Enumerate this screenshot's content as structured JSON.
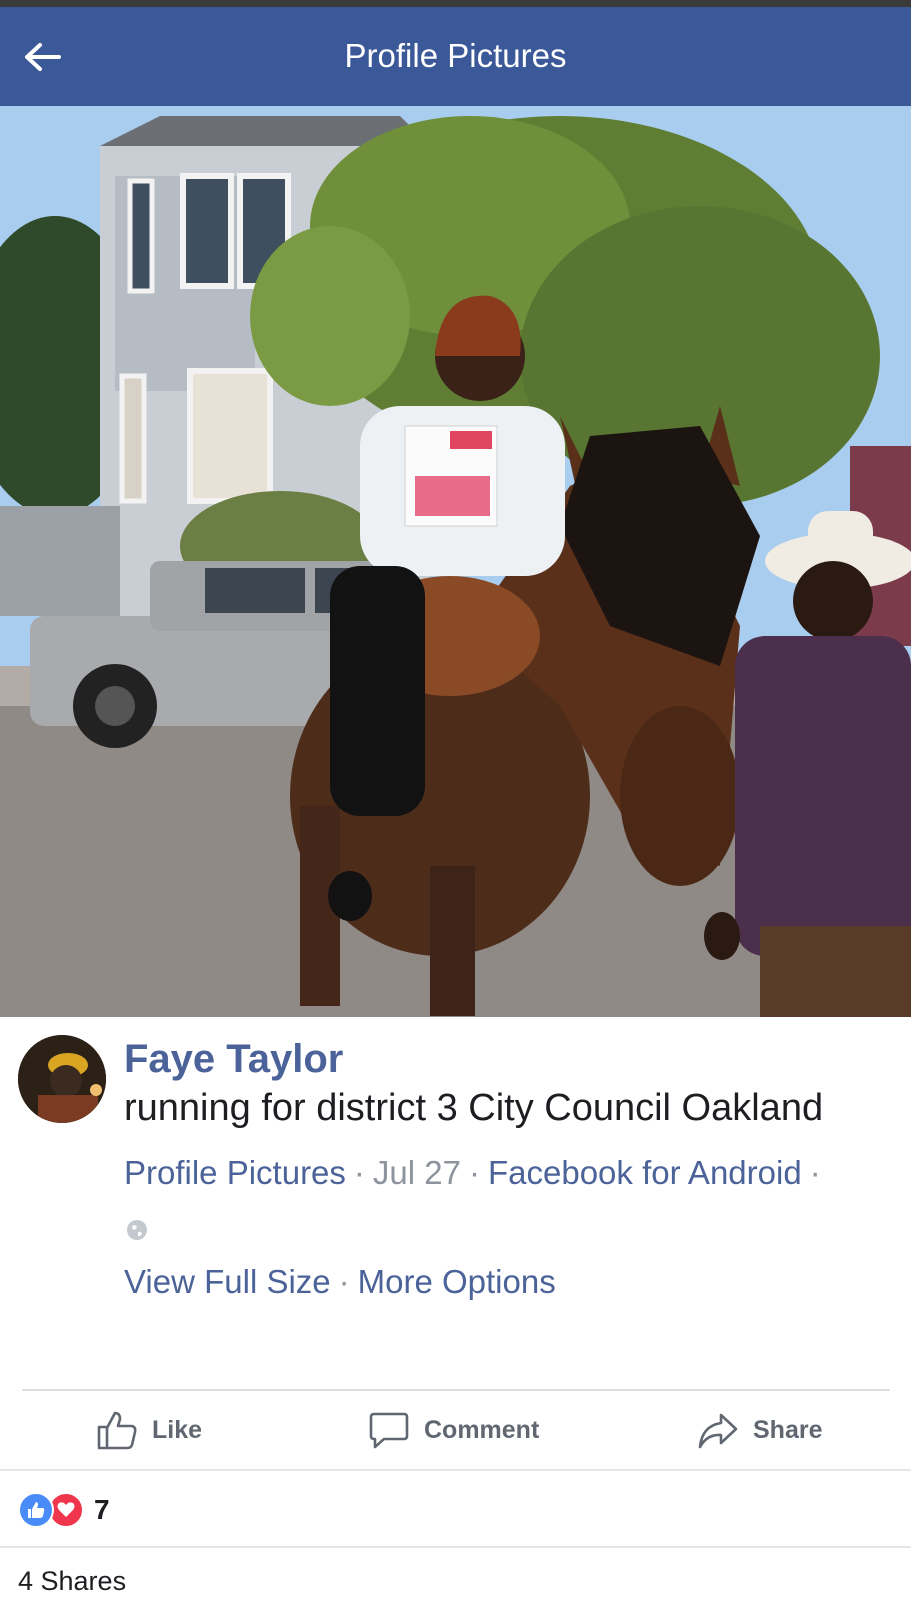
{
  "app_bar": {
    "title": "Profile Pictures",
    "back_icon": "arrow-left-icon"
  },
  "post": {
    "author": "Faye Taylor",
    "caption": "running for district 3 City Council Oakland",
    "album": "Profile Pictures",
    "separator": "·",
    "date": "Jul 27",
    "app": "Facebook for Android",
    "privacy_icon": "globe-icon",
    "view_full_size": "View Full Size",
    "more_options": "More Options"
  },
  "actions": {
    "like_label": "Like",
    "comment_label": "Comment",
    "share_label": "Share"
  },
  "reactions": {
    "count": "7",
    "types": [
      "like",
      "love"
    ]
  },
  "shares_text": "4 Shares",
  "colors": {
    "brand": "#3b5998",
    "link": "#4b6399",
    "like": "#4a8cf7",
    "love": "#f0364c"
  }
}
